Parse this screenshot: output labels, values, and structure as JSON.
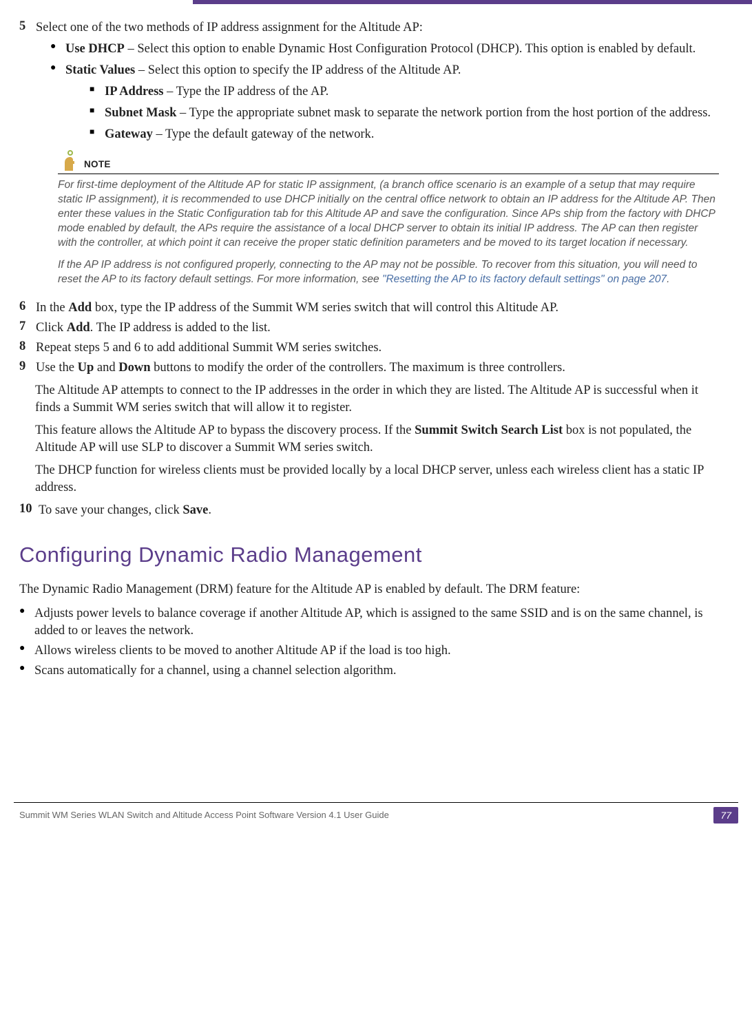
{
  "steps": {
    "5": {
      "num": "5",
      "intro": "Select one of the two methods of IP address assignment for the Altitude AP:",
      "opt1_label": "Use DHCP",
      "opt1_text": " – Select this option to enable Dynamic Host Configuration Protocol (DHCP). This option is enabled by default.",
      "opt2_label": "Static Values",
      "opt2_text": " – Select this option to specify the IP address of the Altitude AP.",
      "sub1_label": "IP Address",
      "sub1_text": " – Type the IP address of the AP.",
      "sub2_label": "Subnet Mask",
      "sub2_text": " – Type the appropriate subnet mask to separate the network portion from the host portion of the address.",
      "sub3_label": "Gateway",
      "sub3_text": " – Type the default gateway of the network."
    },
    "6": {
      "num": "6",
      "t1": "In the ",
      "b1": "Add",
      "t2": " box, type the IP address of the Summit WM series switch that will control this Altitude AP."
    },
    "7": {
      "num": "7",
      "t1": "Click ",
      "b1": "Add",
      "t2": ". The IP address is added to the list."
    },
    "8": {
      "num": "8",
      "t1": "Repeat steps 5 and 6 to add additional Summit WM series switches."
    },
    "9": {
      "num": "9",
      "t1": "Use the ",
      "b1": "Up",
      "t2": " and ",
      "b2": "Down",
      "t3": " buttons to modify the order of the controllers. The maximum is three controllers.",
      "p1": "The Altitude AP attempts to connect to the IP addresses in the order in which they are listed. The Altitude AP is successful when it finds a Summit WM series switch that will allow it to register.",
      "p2a": "This feature allows the Altitude AP to bypass the discovery process. If the ",
      "p2b": "Summit Switch Search List",
      "p2c": " box is not populated, the Altitude AP will use SLP to discover a Summit WM series switch.",
      "p3": "The DHCP function for wireless clients must be provided locally by a local DHCP server, unless each wireless client has a static IP address."
    },
    "10": {
      "num": "10",
      "t1": "To save your changes, click ",
      "b1": "Save",
      "t2": "."
    }
  },
  "note": {
    "label": "NOTE",
    "p1": "For first-time deployment of the Altitude AP for static IP assignment, (a branch office scenario is an example of a setup that may require static IP assignment), it is recommended to use DHCP initially on the central office network to obtain an IP address for the Altitude AP. Then enter these values in the Static Configuration tab for this Altitude AP and save the configuration. Since APs ship from the factory with DHCP mode enabled by default, the APs require the assistance of a local DHCP server to obtain its initial IP address. The AP can then register with the controller, at which point it can receive the proper static definition parameters and be moved to its target location if necessary.",
    "p2a": "If the AP IP address is not configured properly, connecting to the AP may not be possible. To recover from this situation, you will need to reset the AP to its factory default settings. For more information, see ",
    "p2link": "\"Resetting the AP to its factory default settings\" on page 207",
    "p2b": "."
  },
  "section": {
    "heading": "Configuring Dynamic Radio Management",
    "intro": "The Dynamic Radio Management (DRM) feature for the Altitude AP is enabled by default. The DRM feature:",
    "li1": "Adjusts power levels to balance coverage if another Altitude AP, which is assigned to the same SSID and is on the same channel, is added to or leaves the network.",
    "li2": "Allows wireless clients to be moved to another Altitude AP if the load is too high.",
    "li3": "Scans automatically for a channel, using a channel selection algorithm."
  },
  "footer": {
    "text": "Summit WM Series WLAN Switch and Altitude Access Point Software Version 4.1 User Guide",
    "page": "77"
  }
}
